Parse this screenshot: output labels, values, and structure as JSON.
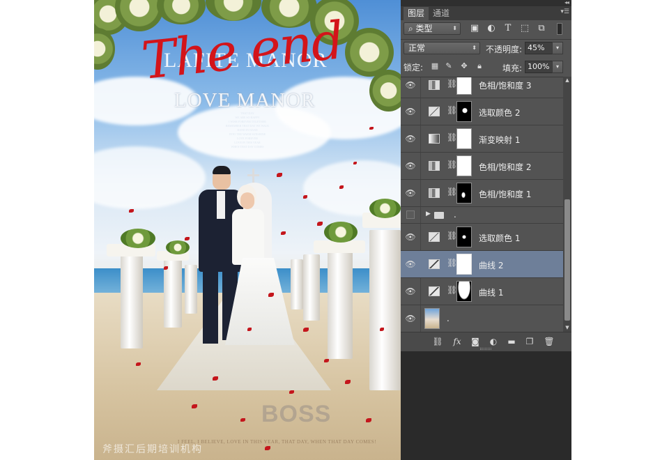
{
  "photo": {
    "title_script": "The end",
    "title_manor": "LAFITE MANOR",
    "title_love": "LOVE MANOR",
    "poem_lines": [
      "THAT DAY",
      "WE ARE SO HAPPY",
      "I WISH FOREVER TOGETHER",
      "REMEMBER THAT DAY WE WALK",
      "HAND IN HAND",
      "INTO THE WARM SUNSHINE",
      "LOVE FOREVER",
      "LOVE IN THIS YEAR",
      "WHEN THAT DAY COMES"
    ],
    "watermark_boss": "BOSS",
    "caption": "I FEEL, I BELIEVE, LOVE IN THIS YEAR, THAT DAY, WHEN THAT DAY COMES!",
    "watermark_cn": "斧摄汇后期培训机构"
  },
  "panel": {
    "tabs": [
      "图层",
      "通道"
    ],
    "filter_label": "类型",
    "blend_mode": "正常",
    "opacity_label": "不透明度:",
    "opacity_value": "45%",
    "lock_label": "锁定:",
    "fill_label": "填充:",
    "fill_value": "100%",
    "layers": [
      {
        "name": "色相/饱和度 3",
        "kind": "hue"
      },
      {
        "name": "选取颜色 2",
        "kind": "selective"
      },
      {
        "name": "渐变映射 1",
        "kind": "gradient"
      },
      {
        "name": "色相/饱和度 2",
        "kind": "hue"
      },
      {
        "name": "色相/饱和度 1",
        "kind": "hue"
      },
      {
        "name": ".",
        "kind": "group"
      },
      {
        "name": "选取颜色 1",
        "kind": "selective"
      },
      {
        "name": "曲线 2",
        "kind": "curves",
        "selected": true
      },
      {
        "name": "曲线 1",
        "kind": "curves"
      },
      {
        "name": ".",
        "kind": "image"
      }
    ],
    "bottom_icons": [
      "link-layers-icon",
      "fx-icon",
      "add-mask-icon",
      "adjustment-icon",
      "new-group-icon",
      "new-layer-icon",
      "trash-icon"
    ],
    "fx_label": "fx"
  },
  "colors": {
    "panel_bg": "#535353",
    "selected_row": "#6e7f99",
    "script_red": "#d3141a"
  }
}
